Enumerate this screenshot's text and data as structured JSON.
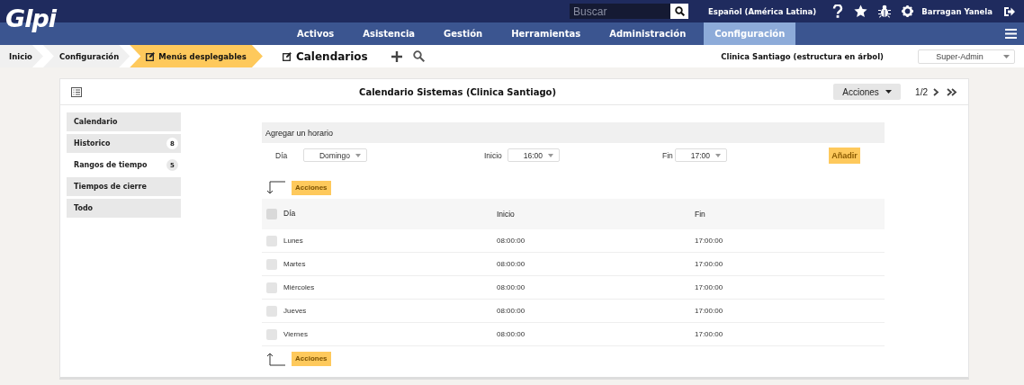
{
  "header": {
    "logo": "Glpi",
    "search": {
      "placeholder": "Buscar"
    },
    "language": "Español (América Latina)",
    "user": "Barragan Yanela"
  },
  "nav": [
    {
      "label": "Activos",
      "selected": false
    },
    {
      "label": "Asistencia",
      "selected": false
    },
    {
      "label": "Gestión",
      "selected": false
    },
    {
      "label": "Herramientas",
      "selected": false
    },
    {
      "label": "Administración",
      "selected": false
    },
    {
      "label": "Configuración",
      "selected": true
    }
  ],
  "breadcrumb": [
    {
      "label": "Inicio",
      "kind": "plain"
    },
    {
      "label": "Configuración",
      "kind": "plain"
    },
    {
      "label": "Menús desplegables",
      "kind": "highlight"
    }
  ],
  "page_title": "Calendarios",
  "entity": "Clinica Santiago (estructura en árbol)",
  "profile": "Super-Admin",
  "panel": {
    "title": "Calendario Sistemas (Clinica Santiago)",
    "actions": "Acciones",
    "pager": "1/2"
  },
  "tabs": [
    {
      "label": "Calendario",
      "selected": false
    },
    {
      "label": "Historico",
      "count": "8",
      "selected": false
    },
    {
      "label": "Rangos de tiempo",
      "count": "5",
      "selected": true
    },
    {
      "label": "Tiempos de cierre",
      "selected": false
    },
    {
      "label": "Todo",
      "selected": false
    }
  ],
  "add_form": {
    "title": "Agregar un horario",
    "fields": [
      {
        "label": "Día",
        "value": "Domingo"
      },
      {
        "label": "Inicio",
        "value": "16:00"
      },
      {
        "label": "Fin",
        "value": "17:00"
      }
    ],
    "button": "Añadir"
  },
  "top_action": "Acciones",
  "bottom_action": "Acciones",
  "table": {
    "columns": [
      "Día",
      "Inicio",
      "Fin"
    ],
    "header_checked": false,
    "rows": [
      {
        "cells": [
          "Lunes",
          "08:00:00",
          "17:00:00"
        ],
        "checked": false
      },
      {
        "cells": [
          "Martes",
          "08:00:00",
          "17:00:00"
        ],
        "checked": false
      },
      {
        "cells": [
          "Miércoles",
          "08:00:00",
          "17:00:00"
        ],
        "checked": false
      },
      {
        "cells": [
          "Jueves",
          "08:00:00",
          "17:00:00"
        ],
        "checked": false
      },
      {
        "cells": [
          "Viernes",
          "08:00:00",
          "17:00:00"
        ],
        "checked": false
      }
    ]
  }
}
